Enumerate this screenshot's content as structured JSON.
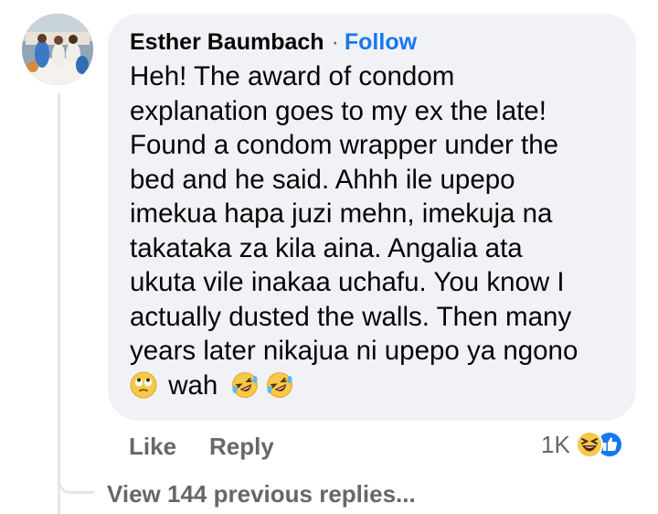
{
  "comment": {
    "author": "Esther Baumbach",
    "separator": "·",
    "follow_label": "Follow",
    "lines": [
      "Heh! The award of condom",
      "explanation goes to my ex the late!",
      "Found a condom wrapper under the",
      "bed and he said. Ahhh ile upepo",
      "imekua hapa juzi mehn, imekuja na",
      "takataka za kila aina.  Angalia ata",
      "ukuta vile inakaa uchafu. You know I",
      "actually dusted the walls. Then many",
      "years later nikajua ni upepo ya ngono"
    ],
    "last_line_text": "wah",
    "last_line_emojis": [
      "face-with-rolling-eyes-icon",
      "rolling-on-floor-laughing-icon",
      "rolling-on-floor-laughing-icon"
    ]
  },
  "actions": {
    "like_label": "Like",
    "reply_label": "Reply"
  },
  "reactions": {
    "count": "1K",
    "icons": [
      "laughing-reaction-icon",
      "like-reaction-icon"
    ]
  },
  "view_replies_label": "View 144 previous replies...",
  "colors": {
    "bubble": "#f0f2f5",
    "follow": "#1877f2",
    "secondary_text": "#65676b",
    "thread_line": "#e4e6eb"
  }
}
